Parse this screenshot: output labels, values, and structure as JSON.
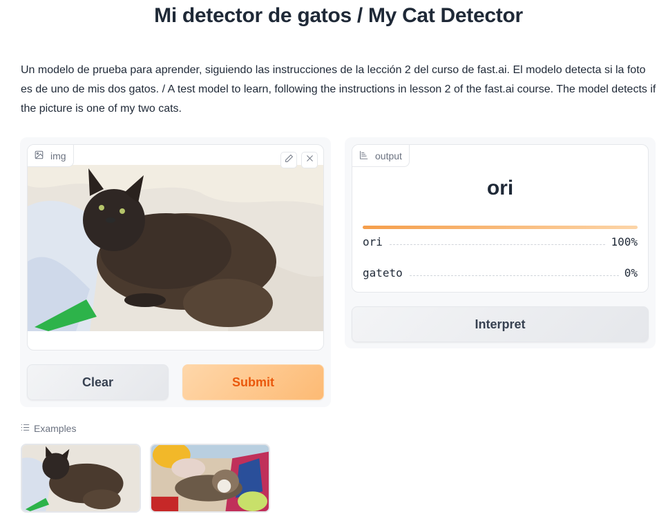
{
  "page": {
    "title": "Mi detector de gatos / My Cat Detector",
    "description": "Un modelo de prueba para aprender, siguiendo las instrucciones de la lección 2 del curso de fast.ai. El modelo detecta si la foto es de uno de mis dos gatos. / A test model to learn, following the instructions in lesson 2 of the fast.ai course. The model detects if the picture is one of my two cats."
  },
  "input": {
    "label": "img",
    "icon": "image-icon",
    "tools": [
      {
        "name": "edit",
        "icon": "pencil-icon"
      },
      {
        "name": "clear",
        "icon": "close-icon"
      }
    ],
    "image_description": "Dark long-haired cat lying on white bed sheets next to a green tube"
  },
  "buttons": {
    "clear": "Clear",
    "submit": "Submit",
    "interpret": "Interpret"
  },
  "output": {
    "label": "output",
    "icon": "bar-chart-icon",
    "predicted": "ori",
    "confidence_fraction": 1.0,
    "confidences": [
      {
        "label": "ori",
        "value": "100%"
      },
      {
        "label": "gateto",
        "value": "0%"
      }
    ]
  },
  "examples": {
    "label": "Examples",
    "icon": "list-icon",
    "items": [
      {
        "description": "Dark long-haired cat on white bed"
      },
      {
        "description": "Tabby cat lying among toys and blankets"
      }
    ]
  },
  "colors": {
    "primary_text": "#ea580c",
    "primary_bg": "#fdba74",
    "bar_start": "#f59e4b",
    "bar_end": "#fcd5a8"
  }
}
